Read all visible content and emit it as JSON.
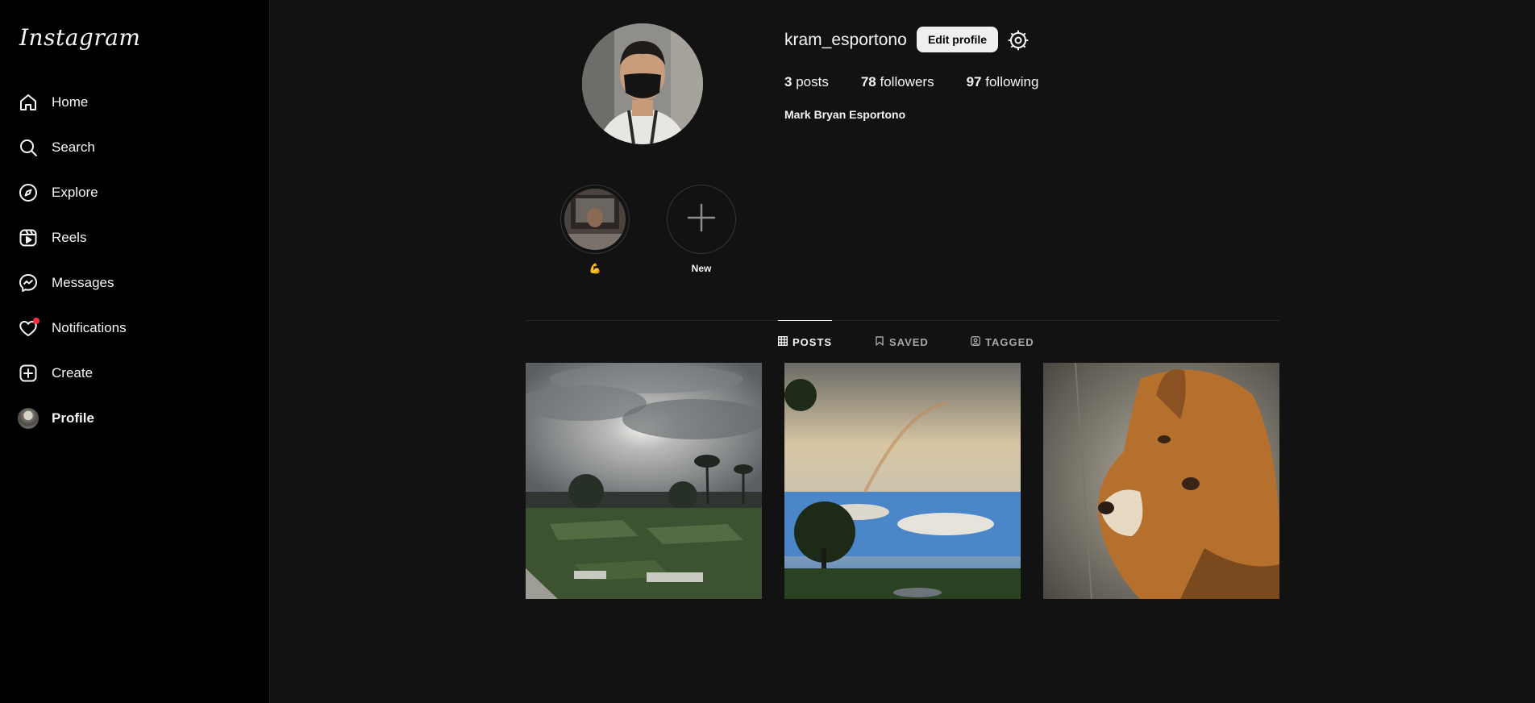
{
  "app": {
    "logo_text": "Instagram"
  },
  "sidebar": {
    "items": [
      {
        "label": "Home",
        "icon": "home-icon"
      },
      {
        "label": "Search",
        "icon": "search-icon"
      },
      {
        "label": "Explore",
        "icon": "compass-icon"
      },
      {
        "label": "Reels",
        "icon": "reels-icon"
      },
      {
        "label": "Messages",
        "icon": "messenger-icon"
      },
      {
        "label": "Notifications",
        "icon": "heart-icon"
      },
      {
        "label": "Create",
        "icon": "plus-square-icon"
      },
      {
        "label": "Profile",
        "icon": "avatar"
      }
    ],
    "active": "Profile"
  },
  "profile": {
    "username": "kram_esportono",
    "edit_label": "Edit profile",
    "posts_count": "3",
    "posts_label": "posts",
    "followers_count": "78",
    "followers_label": "followers",
    "following_count": "97",
    "following_label": "following",
    "full_name": "Mark Bryan Esportono"
  },
  "highlights": [
    {
      "label": "💪"
    },
    {
      "label": "New"
    }
  ],
  "tabs": [
    {
      "label": "POSTS",
      "active": true
    },
    {
      "label": "SAVED",
      "active": false
    },
    {
      "label": "TAGGED",
      "active": false
    }
  ],
  "colors": {
    "background": "#121212",
    "sidebar": "#000000",
    "notification_dot": "#ff3040",
    "edit_button": "#efefef"
  }
}
